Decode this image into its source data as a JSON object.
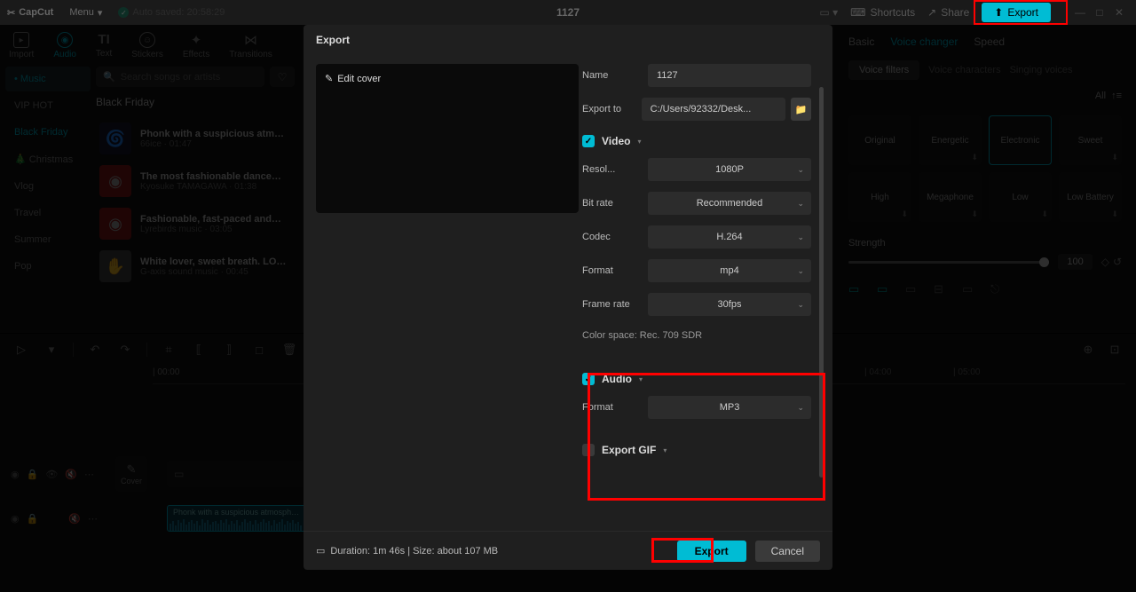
{
  "topbar": {
    "logo": "CapCut",
    "menu": "Menu",
    "autosaved": "Auto saved: 20:58:29",
    "project": "1127",
    "shortcuts": "Shortcuts",
    "share": "Share",
    "export": "Export"
  },
  "tabs": {
    "import": "Import",
    "audio": "Audio",
    "text": "Text",
    "stickers": "Stickers",
    "effects": "Effects",
    "transitions": "Transitions"
  },
  "sidebar": {
    "music": "Music",
    "vip_hot": "VIP HOT",
    "black_friday": "Black Friday",
    "christmas": "Christmas",
    "vlog": "Vlog",
    "travel": "Travel",
    "summer": "Summer",
    "pop": "Pop"
  },
  "search": {
    "placeholder": "Search songs or artists"
  },
  "list": {
    "title": "Black Friday",
    "tracks": [
      {
        "name": "Phonk with a suspicious atm…",
        "artist": "66ice",
        "dur": "01:47"
      },
      {
        "name": "The most fashionable dance…",
        "artist": "Kyosuke TAMAGAWA",
        "dur": "01:38"
      },
      {
        "name": "Fashionable, fast-paced and…",
        "artist": "Lyrebirds music",
        "dur": "03:05"
      },
      {
        "name": "White lover, sweet breath. LO…",
        "artist": "G-axis sound music",
        "dur": "00:45"
      }
    ]
  },
  "right": {
    "tabs": {
      "basic": "Basic",
      "voice_changer": "Voice changer",
      "speed": "Speed"
    },
    "filters": {
      "voice_filters": "Voice filters",
      "voice_characters": "Voice characters",
      "singing": "Singing voices"
    },
    "all": "All",
    "presets": [
      "Original",
      "Energetic",
      "Electronic",
      "Sweet",
      "High",
      "Megaphone",
      "Low",
      "Low Battery"
    ],
    "strength_label": "Strength",
    "strength_value": "100"
  },
  "timeline": {
    "times": [
      "00:00",
      "04:00",
      "05:00"
    ],
    "cover": "Cover",
    "audio_clip": "Phonk with a suspicious atmosph…"
  },
  "modal": {
    "title": "Export",
    "edit_cover": "Edit cover",
    "name_label": "Name",
    "name_value": "1127",
    "export_to_label": "Export to",
    "export_to_value": "C:/Users/92332/Desk...",
    "video_label": "Video",
    "resolution_label": "Resol...",
    "resolution_value": "1080P",
    "bitrate_label": "Bit rate",
    "bitrate_value": "Recommended",
    "codec_label": "Codec",
    "codec_value": "H.264",
    "format_label": "Format",
    "format_value": "mp4",
    "framerate_label": "Frame rate",
    "framerate_value": "30fps",
    "colorspace": "Color space: Rec. 709 SDR",
    "audio_label": "Audio",
    "audio_format_label": "Format",
    "audio_format_value": "MP3",
    "gif_label": "Export GIF",
    "duration": "Duration: 1m 46s | Size: about 107 MB",
    "export_btn": "Export",
    "cancel_btn": "Cancel"
  }
}
